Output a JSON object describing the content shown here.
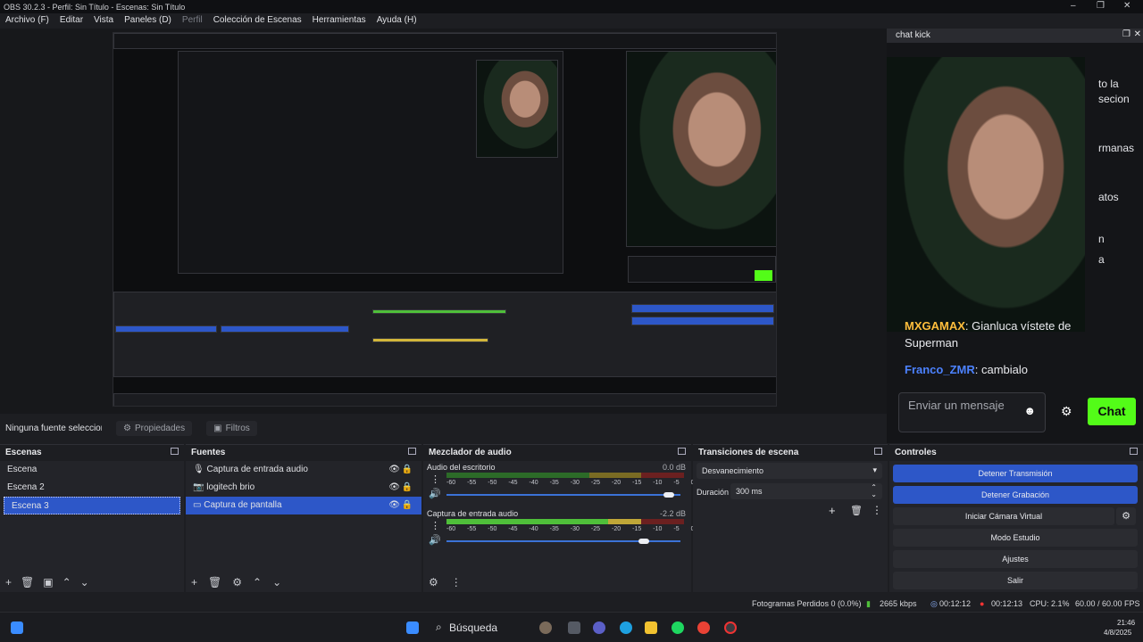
{
  "window": {
    "title": "OBS 30.2.3 - Perfil: Sin Título - Escenas: Sin Título"
  },
  "menu": [
    {
      "label": "Archivo (F)",
      "enabled": true
    },
    {
      "label": "Editar",
      "enabled": true
    },
    {
      "label": "Vista",
      "enabled": true
    },
    {
      "label": "Paneles (D)",
      "enabled": true
    },
    {
      "label": "Perfil",
      "enabled": false
    },
    {
      "label": "Colección de Escenas",
      "enabled": true
    },
    {
      "label": "Herramientas",
      "enabled": true
    },
    {
      "label": "Ayuda (H)",
      "enabled": true
    }
  ],
  "chat": {
    "title": "chat kick",
    "messages": [
      {
        "user": "MXGAMAX",
        "user_color": "#ffbe3c",
        "text": ": Gianluca vístete de Superman"
      },
      {
        "user": "Franco_ZMR",
        "user_color": "#4c82ff",
        "text": ": cambialo"
      }
    ],
    "input_placeholder": "Enviar un mensaje",
    "send_label": "Chat",
    "overlay_fragments": [
      "to la",
      "secion",
      "rmanas",
      "atos",
      "n",
      "a"
    ]
  },
  "source_toolbar": {
    "no_source": "Ninguna fuente seleccionada",
    "properties": "Propiedades",
    "filters": "Filtros"
  },
  "scenes": {
    "title": "Escenas",
    "items": [
      "Escena",
      "Escena 2",
      "Escena 3"
    ],
    "selected": 2
  },
  "sources": {
    "title": "Fuentes",
    "items": [
      {
        "label": "Captura de entrada audio",
        "icon": "microphone-icon"
      },
      {
        "label": "logitech brio",
        "icon": "camera-icon"
      },
      {
        "label": "Captura de pantalla",
        "icon": "monitor-icon"
      }
    ],
    "selected": 2
  },
  "mixer": {
    "title": "Mezclador de audio",
    "channels": [
      {
        "name": "Audio del escritorio",
        "db": "0.0 dB",
        "level": 0.78,
        "volume": 0.97
      },
      {
        "name": "Captura de entrada audio",
        "db": "-2.2 dB",
        "level": 0.84,
        "volume": 0.86
      }
    ],
    "ticks": [
      "-60",
      "-55",
      "-50",
      "-45",
      "-40",
      "-35",
      "-30",
      "-25",
      "-20",
      "-15",
      "-10",
      "-5",
      "0"
    ]
  },
  "transitions": {
    "title": "Transiciones de escena",
    "type": "Desvanecimiento",
    "duration_label": "Duración",
    "duration_value": "300 ms"
  },
  "controls": {
    "title": "Controles",
    "buttons": [
      {
        "label": "Detener Transmisión",
        "active": true
      },
      {
        "label": "Detener Grabación",
        "active": true
      },
      {
        "label": "Iniciar Cámara Virtual",
        "active": false
      },
      {
        "label": "Modo Estudio",
        "active": false
      },
      {
        "label": "Ajustes",
        "active": false
      },
      {
        "label": "Salir",
        "active": false
      }
    ]
  },
  "status": {
    "dropped": "Fotogramas Perdidos 0 (0.0%)",
    "bitrate": "2665 kbps",
    "stream_time": "00:12:12",
    "rec_time": "00:12:13",
    "cpu": "CPU: 2.1%",
    "fps": "60.00 / 60.00 FPS"
  },
  "taskbar": {
    "search": "Búsqueda",
    "time": "21:46",
    "date": "4/8/2025"
  }
}
